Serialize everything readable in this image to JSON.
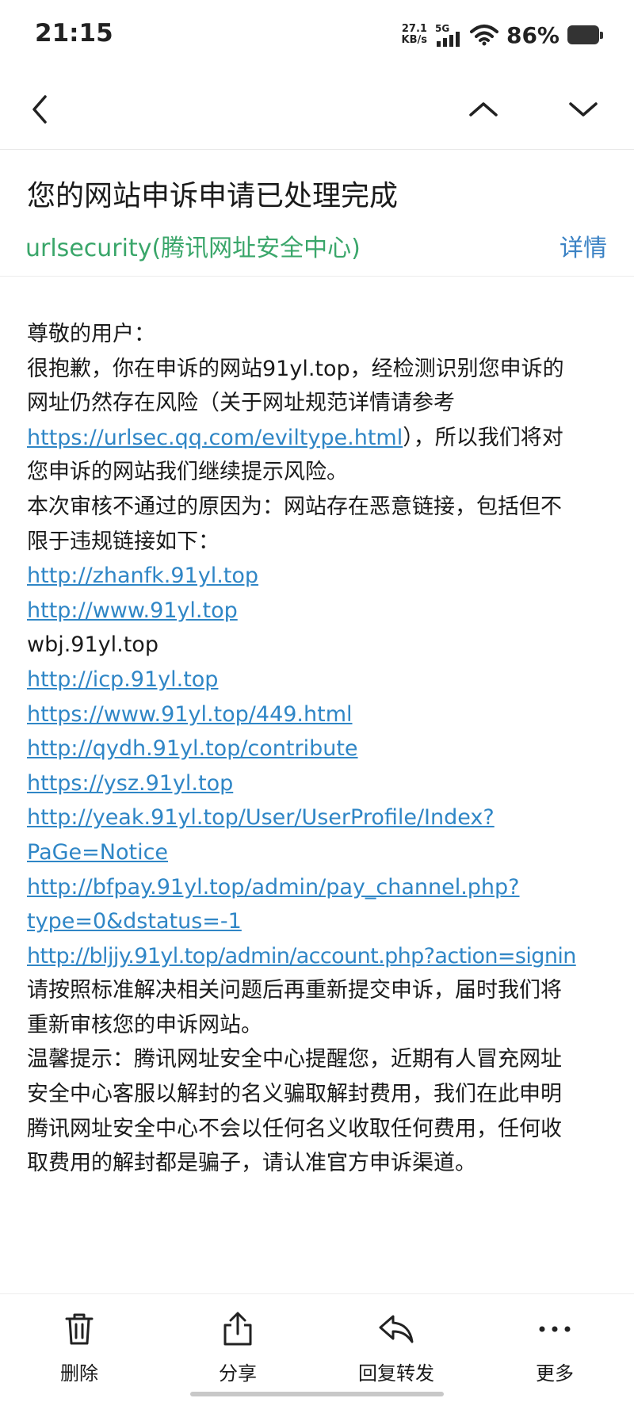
{
  "status": {
    "time": "21:15",
    "net_speed_value": "27.1",
    "net_speed_unit": "KB/s",
    "network": "5G",
    "battery": "86%"
  },
  "nav": {
    "back_icon": "chevron-left-icon",
    "prev_icon": "chevron-up-icon",
    "next_icon": "chevron-down-icon"
  },
  "mail": {
    "subject": "您的网站申诉申请已处理完成",
    "sender": "urlsecurity(腾讯网址安全中心)",
    "details_label": "详情",
    "body": {
      "greeting": "尊敬的用户：",
      "p1_line1": "很抱歉，你在申诉的网站91yl.top，经检测识别您申诉的",
      "p1_line2": "网址仍然存在风险（关于网址规范详情请参考",
      "p1_link": "https://urlsec.qq.com/eviltype.html",
      "p1_line3_rest": "），所以我们将对",
      "p1_line4": "您申诉的网站我们继续提示风险。",
      "reason_line1": "本次审核不通过的原因为：网站存在恶意链接，包括但不",
      "reason_line2": "限于违规链接如下：",
      "links": {
        "l1": "http://zhanfk.91yl.top",
        "l2": "http://www.91yl.top",
        "plain": "wbj.91yl.top",
        "l3": "http://icp.91yl.top",
        "l4": "https://www.91yl.top/449.html",
        "l5": "http://qydh.91yl.top/contribute",
        "l6": "https://ysz.91yl.top",
        "l7a": "http://yeak.91yl.top/User/UserProfile/Index?",
        "l7b": "PaGe=Notice",
        "l8a": "http://bfpay.91yl.top/admin/pay_channel.php?",
        "l8b": "type=0&dstatus=-1",
        "l9": "http://bljjy.91yl.top/admin/account.php?action=signin"
      },
      "resubmit_line1": "请按照标准解决相关问题后再重新提交申诉，届时我们将",
      "resubmit_line2": "重新审核您的申诉网站。",
      "tip_line1": "温馨提示：腾讯网址安全中心提醒您，近期有人冒充网址",
      "tip_line2": "安全中心客服以解封的名义骗取解封费用，我们在此申明",
      "tip_line3": "腾讯网址安全中心不会以任何名义收取任何费用，任何收",
      "tip_line4": "取费用的解封都是骗子，请认准官方申诉渠道。"
    }
  },
  "toolbar": {
    "delete_label": "删除",
    "share_label": "分享",
    "reply_label": "回复转发",
    "more_label": "更多",
    "delete_icon": "trash-icon",
    "share_icon": "share-icon",
    "reply_icon": "reply-icon",
    "more_icon": "more-dots-icon"
  }
}
